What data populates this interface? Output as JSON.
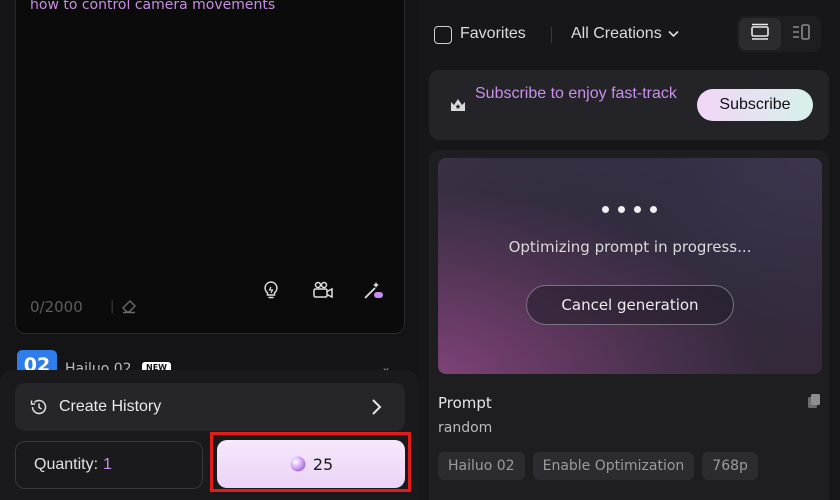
{
  "prompt_panel": {
    "prompt_text": "how to control camera movements",
    "char_count": "0/2000",
    "separator": "|"
  },
  "model": {
    "badge": "02",
    "name": "Hailuo 02",
    "new_tag": "NEW"
  },
  "bottom": {
    "history_label": "Create History",
    "quantity_label": "Quantity:",
    "quantity_value": "1",
    "generate_cost": "25"
  },
  "filters": {
    "favorites_label": "Favorites",
    "creations_select": "All Creations"
  },
  "subscribe": {
    "text": "Subscribe to enjoy fast-track",
    "button": "Subscribe"
  },
  "creation": {
    "progress_text": "Optimizing prompt in progress...",
    "cancel_label": "Cancel generation",
    "prompt_heading": "Prompt",
    "prompt_value": "random",
    "tags": [
      "Hailuo 02",
      "Enable Optimization",
      "768p"
    ]
  },
  "colors": {
    "accent_purple": "#c890ec",
    "highlight_red": "#e21b1b",
    "model_blue": "#2f7de8"
  },
  "icons": [
    "eraser-icon",
    "bulb-icon",
    "camera-icon",
    "magic-wand-icon",
    "history-icon",
    "chevron-right-icon",
    "gem-icon",
    "chevron-down-icon",
    "card-view-icon",
    "list-view-icon",
    "crown-icon",
    "copy-icon"
  ]
}
